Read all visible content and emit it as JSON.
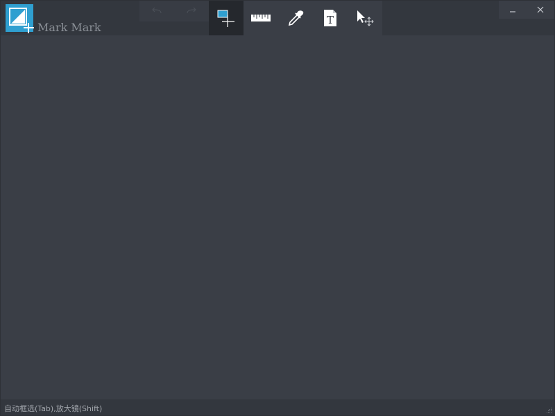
{
  "app": {
    "name": "Mark Mark"
  },
  "toolbar": {
    "undo_icon": "undo-icon",
    "redo_icon": "redo-icon",
    "tools": [
      {
        "icon": "rectangle-select-icon",
        "active": true
      },
      {
        "icon": "ruler-icon",
        "active": false
      },
      {
        "icon": "eyedropper-icon",
        "active": false
      },
      {
        "icon": "text-icon",
        "active": false
      },
      {
        "icon": "move-cursor-icon",
        "active": false
      }
    ]
  },
  "window_controls": {
    "minimize": "–",
    "close": "×"
  },
  "status": {
    "text": "自动框选(Tab),放大镜(Shift)"
  },
  "colors": {
    "accent": "#2f9fd0",
    "background": "#3a3e46",
    "titlebar": "#33373e",
    "active_tool": "#25282d"
  }
}
